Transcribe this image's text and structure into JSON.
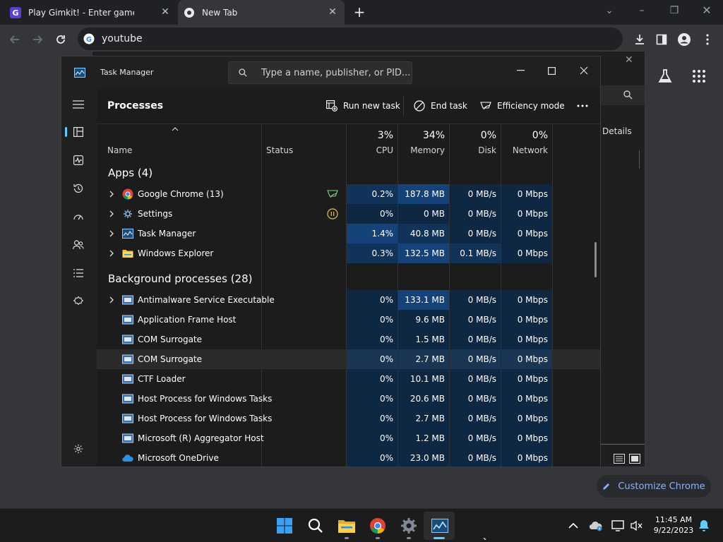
{
  "browser": {
    "tabs": [
      {
        "title": "Play Gimkit! - Enter game code h"
      },
      {
        "title": "New Tab"
      }
    ],
    "omnibox": {
      "value": "youtube"
    }
  },
  "ntp": {
    "customize_label": "Customize Chrome",
    "behind_details": "Details"
  },
  "taskmanager": {
    "title": "Task Manager",
    "search_placeholder": "Type a name, publisher, or PID...",
    "page_title": "Processes",
    "commands": {
      "run_new_task": "Run new task",
      "end_task": "End task",
      "efficiency_mode": "Efficiency mode"
    },
    "columns": {
      "name": "Name",
      "status": "Status",
      "cpu": {
        "pct": "3%",
        "label": "CPU"
      },
      "memory": {
        "pct": "34%",
        "label": "Memory"
      },
      "disk": {
        "pct": "0%",
        "label": "Disk"
      },
      "network": {
        "pct": "0%",
        "label": "Network"
      }
    },
    "groups": {
      "apps": "Apps (4)",
      "background": "Background processes (28)"
    },
    "apps": [
      {
        "name": "Google Chrome (13)",
        "cpu": "0.2%",
        "memory": "187.8 MB",
        "disk": "0 MB/s",
        "network": "0 Mbps"
      },
      {
        "name": "Settings",
        "cpu": "0%",
        "memory": "0 MB",
        "disk": "0 MB/s",
        "network": "0 Mbps"
      },
      {
        "name": "Task Manager",
        "cpu": "1.4%",
        "memory": "40.8 MB",
        "disk": "0 MB/s",
        "network": "0 Mbps"
      },
      {
        "name": "Windows Explorer",
        "cpu": "0.3%",
        "memory": "132.5 MB",
        "disk": "0.1 MB/s",
        "network": "0 Mbps"
      }
    ],
    "background": [
      {
        "name": "Antimalware Service Executable",
        "cpu": "0%",
        "memory": "133.1 MB",
        "disk": "0 MB/s",
        "network": "0 Mbps"
      },
      {
        "name": "Application Frame Host",
        "cpu": "0%",
        "memory": "9.6 MB",
        "disk": "0 MB/s",
        "network": "0 Mbps"
      },
      {
        "name": "COM Surrogate",
        "cpu": "0%",
        "memory": "1.5 MB",
        "disk": "0 MB/s",
        "network": "0 Mbps"
      },
      {
        "name": "COM Surrogate",
        "cpu": "0%",
        "memory": "2.7 MB",
        "disk": "0 MB/s",
        "network": "0 Mbps"
      },
      {
        "name": "CTF Loader",
        "cpu": "0%",
        "memory": "10.1 MB",
        "disk": "0 MB/s",
        "network": "0 Mbps"
      },
      {
        "name": "Host Process for Windows Tasks",
        "cpu": "0%",
        "memory": "20.6 MB",
        "disk": "0 MB/s",
        "network": "0 Mbps"
      },
      {
        "name": "Host Process for Windows Tasks",
        "cpu": "0%",
        "memory": "2.7 MB",
        "disk": "0 MB/s",
        "network": "0 Mbps"
      },
      {
        "name": "Microsoft (R) Aggregator Host",
        "cpu": "0%",
        "memory": "1.2 MB",
        "disk": "0 MB/s",
        "network": "0 Mbps"
      },
      {
        "name": "Microsoft OneDrive",
        "cpu": "0%",
        "memory": "23.0 MB",
        "disk": "0 MB/s",
        "network": "0 Mbps"
      }
    ]
  },
  "taskbar": {
    "time": "11:45 AM",
    "date": "9/22/2023"
  },
  "colors": {
    "accent": "#60cdff",
    "heat_low": "#0e2743",
    "heat_mid": "#11335a",
    "heat_high": "#16427a"
  }
}
